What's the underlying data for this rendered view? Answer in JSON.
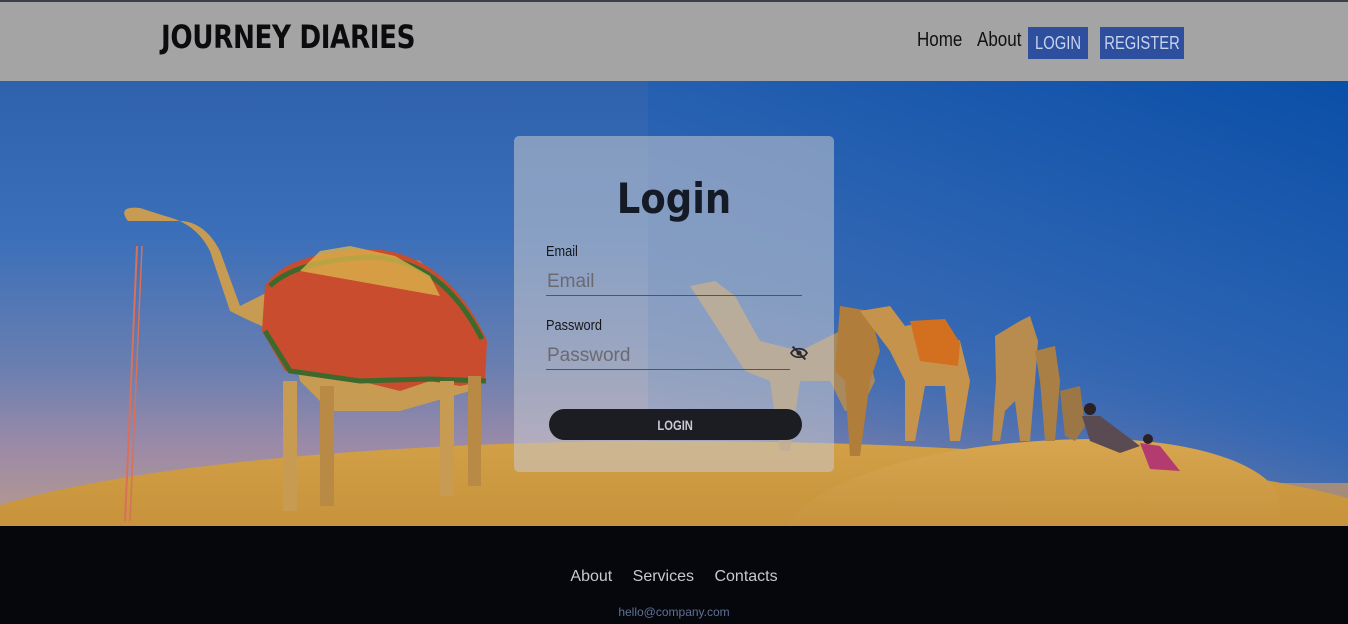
{
  "header": {
    "brand": "JOURNEY DIARIES",
    "nav": {
      "home": "Home",
      "about": "About",
      "login": "LOGIN",
      "register": "REGISTER"
    }
  },
  "login_card": {
    "title": "Login",
    "email": {
      "label": "Email",
      "placeholder": "Email",
      "value": ""
    },
    "password": {
      "label": "Password",
      "placeholder": "Password",
      "value": ""
    },
    "submit_label": "LOGIN",
    "toggle_icon": "eye-slash-icon"
  },
  "footer": {
    "links": [
      "About",
      "Services",
      "Contacts"
    ],
    "email": "hello@company.com"
  },
  "colors": {
    "header_bg": "#a4a4a4",
    "nav_button_bg": "#2d4f9e",
    "footer_bg": "#06070c",
    "login_button_bg": "#1c1d22"
  }
}
